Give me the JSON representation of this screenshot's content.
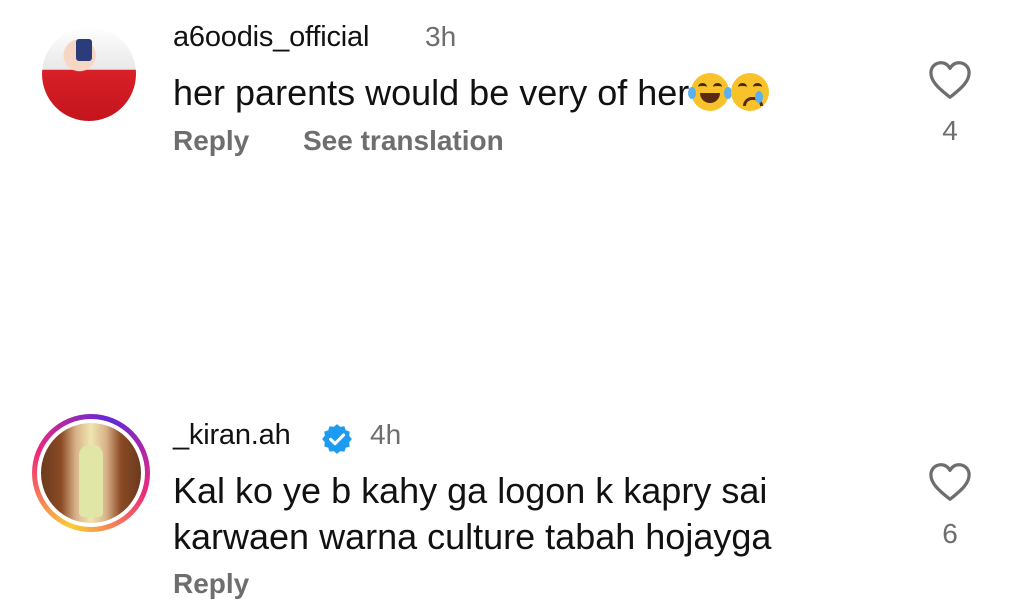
{
  "comments": [
    {
      "username": "a6oodis_official",
      "time": "3h",
      "text": "her parents would be very of her",
      "emojis": [
        "face-with-tears-of-joy",
        "crying-face"
      ],
      "actions": {
        "reply": "Reply",
        "translate": "See translation"
      },
      "likes": "4",
      "avatar": "user-avatar-photo"
    },
    {
      "username": "_kiran.ah",
      "verified": true,
      "time": "4h",
      "text_lines": [
        "Kal ko ye b kahy ga logon k kapry sai",
        "karwaen warna culture tabah hojayga"
      ],
      "actions": {
        "reply": "Reply"
      },
      "likes": "6",
      "avatar": "user-avatar-photo",
      "story_ring": true
    }
  ],
  "colors": {
    "text": "#111111",
    "muted": "#6e6e6e",
    "verified": "#1d9bf0"
  }
}
